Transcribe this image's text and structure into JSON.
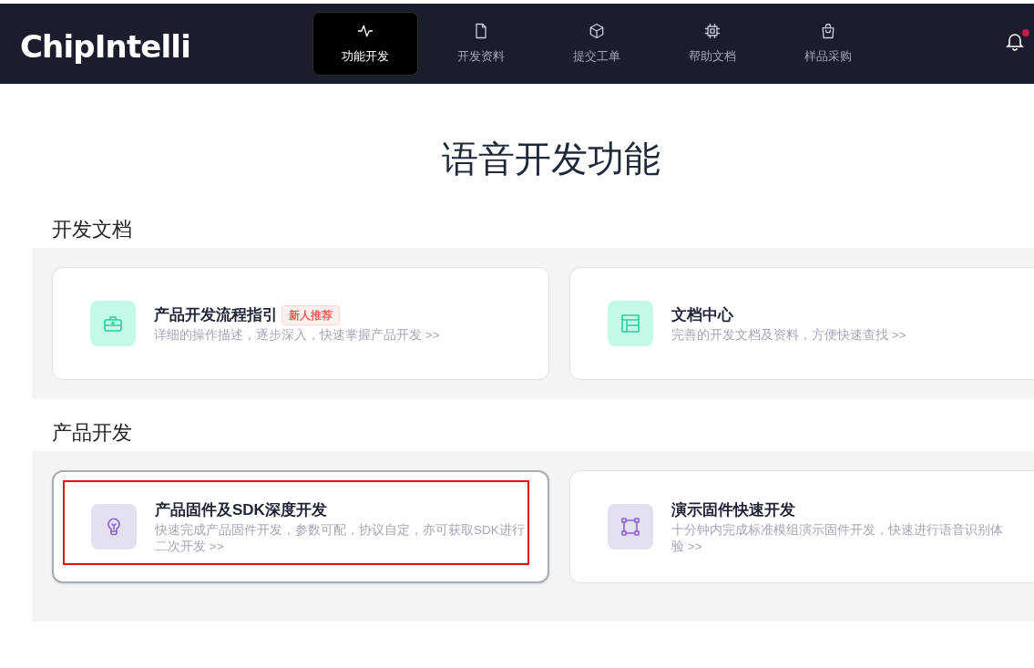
{
  "header": {
    "logo": "ChipIntelli",
    "nav": [
      {
        "label": "功能开发",
        "selected": true
      },
      {
        "label": "开发资料",
        "selected": false
      },
      {
        "label": "提交工单",
        "selected": false
      },
      {
        "label": "帮助文档",
        "selected": false
      },
      {
        "label": "样品采购",
        "selected": false
      }
    ],
    "notifications": {
      "unread": true
    }
  },
  "page_title": "语音开发功能",
  "sections": [
    {
      "title": "开发文档",
      "cards": [
        {
          "title": "产品开发流程指引",
          "badge": "新人推荐",
          "description": "详细的操作描述，逐步深入，快速掌握产品开发 >>",
          "color": "#c3f9e9",
          "selected": false
        },
        {
          "title": "文档中心",
          "description": "完善的开发文档及资料，方便快速查找 >>",
          "color": "#c3f9e9",
          "selected": false
        }
      ]
    },
    {
      "title": "产品开发",
      "cards": [
        {
          "title": "产品固件及SDK深度开发",
          "description": "快速完成产品固件开发，参数可配，协议自定，亦可获取SDK进行二次开发 >>",
          "color": "#e5e0ef",
          "selected": true
        },
        {
          "title": "演示固件快速开发",
          "description": "十分钟内完成标准模组演示固件开发，快速进行语音识别体验 >>",
          "color": "#e5e0ef",
          "selected": false
        }
      ]
    }
  ]
}
